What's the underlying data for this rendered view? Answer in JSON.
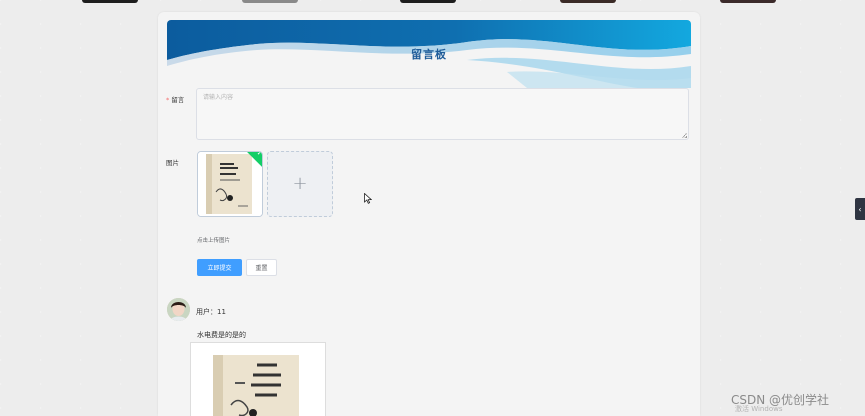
{
  "board": {
    "title": "留言板"
  },
  "form": {
    "message_label": "留言",
    "required_mark": "*",
    "message_placeholder": "请输入内容",
    "message_value": "",
    "image_label": "图片",
    "add_symbol": "+",
    "upload_tip": "点击上传图片",
    "submit_label": "立即提交",
    "reset_label": "重置"
  },
  "comments": [
    {
      "user": "用户：11",
      "text": "水电费是的是的"
    }
  ],
  "watermark": {
    "text": "CSDN @优创学社",
    "activation": "激活 Windows"
  },
  "icons": {
    "success": "check-icon",
    "add": "plus-icon",
    "collapse": "chevron-left-icon",
    "cursor": "mouse-cursor-icon"
  },
  "colors": {
    "primary": "#409eff",
    "banner_blue": "#0f6fb0",
    "banner_cyan": "#13a8df",
    "success": "#13ce66",
    "title": "#1f5c99"
  }
}
